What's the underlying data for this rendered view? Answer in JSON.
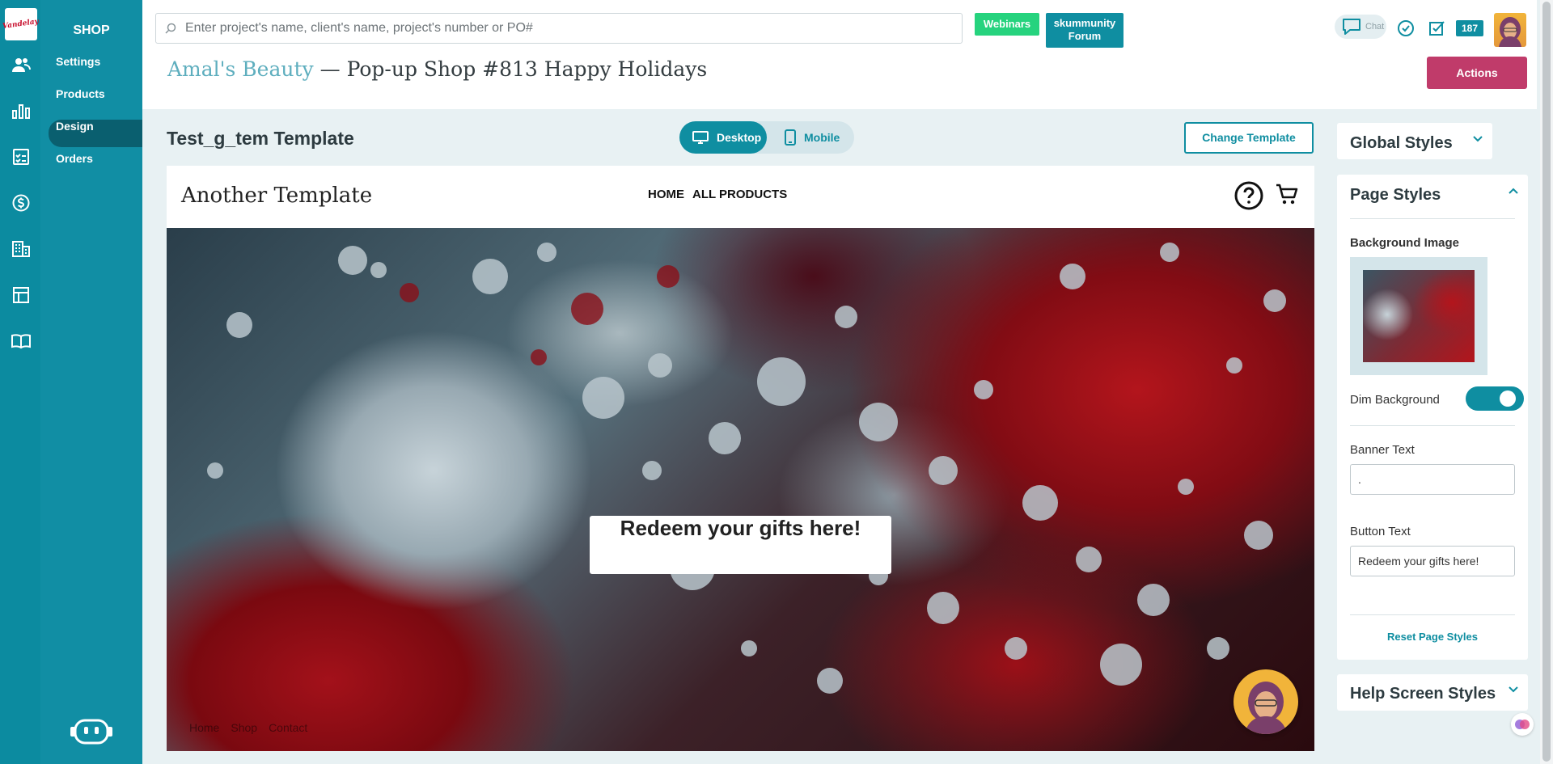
{
  "brand": {
    "logo_text": "Vandelay"
  },
  "subnav": {
    "title": "SHOP",
    "items": [
      {
        "label": "Settings"
      },
      {
        "label": "Products"
      },
      {
        "label": "Design"
      },
      {
        "label": "Orders"
      }
    ]
  },
  "topbar": {
    "search_placeholder": "Enter project's name, client's name, project's number or PO#",
    "webinars_label": "Webinars",
    "forum_label_line1": "skummunity",
    "forum_label_line2": "Forum",
    "chat_label": "Chat",
    "notification_count": "187"
  },
  "page": {
    "client_name": "Amal's Beauty",
    "separator": " — ",
    "project_title": "Pop-up Shop #813 Happy Holidays",
    "actions_label": "Actions"
  },
  "editor": {
    "template_name": "Test_g_tem Template",
    "view_desktop": "Desktop",
    "view_mobile": "Mobile",
    "change_template_label": "Change Template"
  },
  "preview": {
    "brand": "Another Template",
    "nav": [
      "HOME",
      "ALL PRODUCTS"
    ],
    "hero_button_text": "Redeem your gifts here!",
    "footer_links": [
      "Home",
      "Shop",
      "Contact"
    ]
  },
  "panel": {
    "global_styles": "Global Styles",
    "page_styles": "Page Styles",
    "background_image_label": "Background Image",
    "dim_background_label": "Dim Background",
    "dim_background_on": true,
    "banner_text_label": "Banner Text",
    "banner_text_value": ".",
    "button_text_label": "Button Text",
    "button_text_value": "Redeem your gifts here!",
    "reset_label": "Reset Page Styles",
    "help_screen_styles": "Help Screen Styles"
  },
  "colors": {
    "teal": "#0f8ea1",
    "actions": "#c03b6a",
    "webinars": "#26d37e"
  },
  "icons": {
    "rail": [
      "users-icon",
      "bar-chart-icon",
      "checklist-icon",
      "dollar-icon",
      "building-icon",
      "table-icon",
      "book-icon"
    ]
  }
}
